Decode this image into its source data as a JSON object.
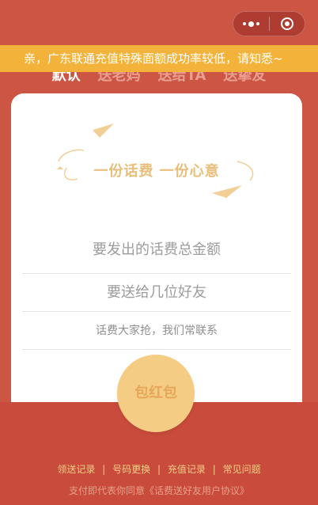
{
  "capsule": {
    "more_icon": "more-dots-icon",
    "close_icon": "target-close-icon"
  },
  "notice": {
    "text": "亲，广东联通充值特殊面额成功率较低，请知悉~"
  },
  "tabs": [
    {
      "label": "默认"
    },
    {
      "label": "送老妈"
    },
    {
      "label": "送给TA"
    },
    {
      "label": "送挚友"
    }
  ],
  "card": {
    "slogan": "一份话费 一份心意",
    "amount_placeholder": "要发出的话费总金额",
    "friends_placeholder": "要送给几位好友",
    "message_placeholder": "话费大家抢，我们常联系"
  },
  "send_button": {
    "label": "包红包"
  },
  "footer": {
    "links": [
      "领送记录",
      "号码更换",
      "充值记录",
      "常见问题"
    ],
    "separator": "|",
    "agreement": "支付即代表你同意《话费送好友用户协议》"
  },
  "colors": {
    "background": "#cc5544",
    "notice": "#f3b33a",
    "button": "#f4cc83",
    "gold_text": "#e9be7a"
  }
}
